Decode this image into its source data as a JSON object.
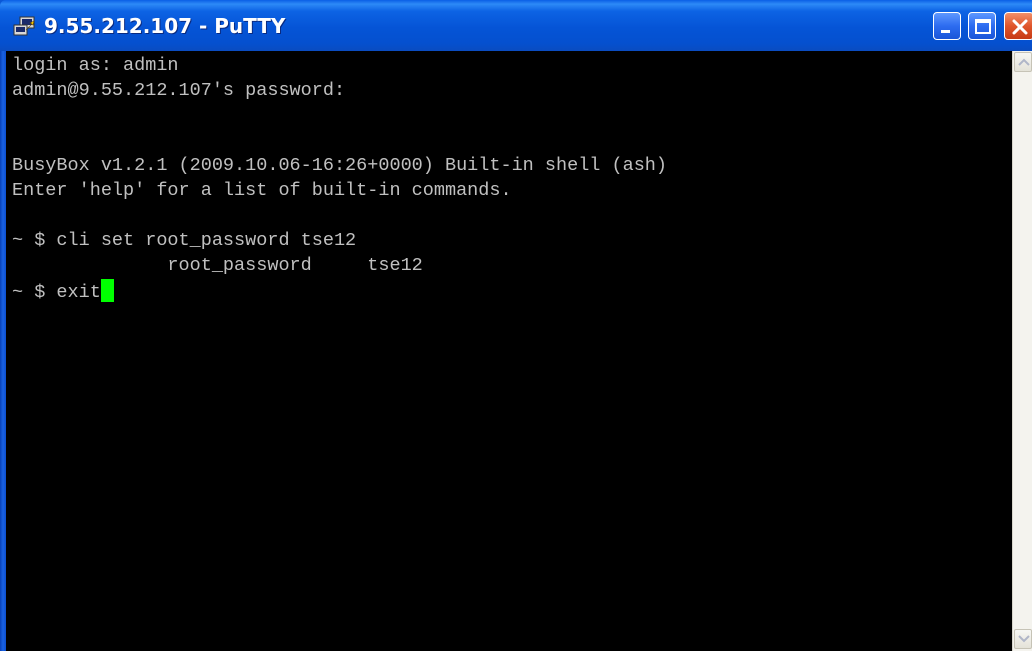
{
  "window": {
    "title": "9.55.212.107 - PuTTY",
    "icon": "putty-icon",
    "title_bar_color": "#0a57d6",
    "controls": {
      "minimize_icon": "minimize-icon",
      "maximize_icon": "maximize-icon",
      "close_icon": "close-icon"
    }
  },
  "terminal": {
    "background": "#000000",
    "text_color": "#c0c0c0",
    "cursor_color": "#00ff00",
    "lines": [
      "login as: admin",
      "admin@9.55.212.107's password:",
      "",
      "",
      "BusyBox v1.2.1 (2009.10.06-16:26+0000) Built-in shell (ash)",
      "Enter 'help' for a list of built-in commands.",
      "",
      "~ $ cli set root_password tse12",
      "              root_password     tse12",
      "~ $ exit"
    ]
  },
  "scrollbar": {
    "up_icon": "scroll-up-arrow-icon",
    "down_icon": "scroll-down-arrow-icon"
  }
}
